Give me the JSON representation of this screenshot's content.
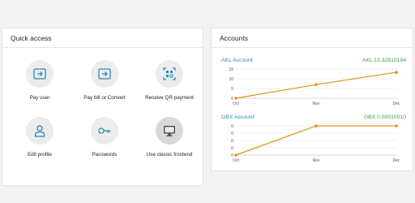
{
  "quick_access": {
    "title": "Quick access",
    "items": [
      {
        "label": "Pay user",
        "icon": "wallet-arrow-icon"
      },
      {
        "label": "Pay bill or Convert",
        "icon": "wallet-arrow-icon"
      },
      {
        "label": "Receive QR payment",
        "icon": "qr-code-icon"
      },
      {
        "label": "Edit profile",
        "icon": "user-icon"
      },
      {
        "label": "Passwords",
        "icon": "key-icon"
      },
      {
        "label": "Use classic frontend",
        "icon": "monitor-icon"
      }
    ]
  },
  "accounts": {
    "title": "Accounts",
    "colors": {
      "link": "#2a8ab8",
      "balance": "#3e9e3e",
      "line": "#e8901a"
    },
    "list": [
      {
        "name": "AKL Account",
        "balance": "AKL 13.32810194",
        "chart_data": {
          "type": "line",
          "categories": [
            "Oct",
            "Nov",
            "Dec"
          ],
          "values": [
            0,
            7,
            13.3
          ],
          "yticks": [
            "15",
            "10",
            "5",
            "0"
          ],
          "ylim": [
            0,
            15
          ]
        }
      },
      {
        "name": "GBX Account",
        "balance": "GBX 0.00010010",
        "chart_data": {
          "type": "line",
          "categories": [
            "Oct",
            "Nov",
            "Dec"
          ],
          "values": [
            0,
            0.0001,
            0.0001
          ],
          "yticks": [
            "0",
            "0",
            "0",
            "0",
            "0"
          ],
          "ylim": [
            0,
            0.0001
          ]
        }
      }
    ]
  }
}
